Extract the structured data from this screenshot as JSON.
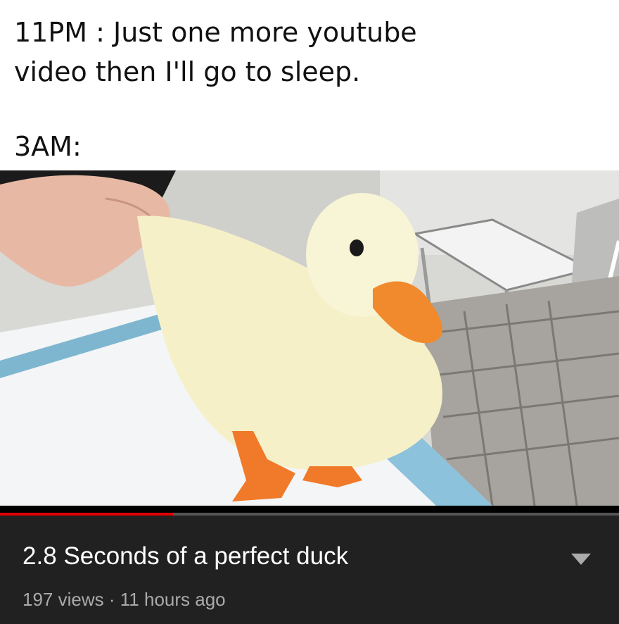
{
  "caption": {
    "line1": "11PM : Just one more youtube",
    "line2": "video then I'll go to sleep.",
    "line3": "3AM:"
  },
  "player": {
    "progress": 0.28,
    "played_color": "#e10000"
  },
  "video_info": {
    "title": "2.8 Seconds of a perfect duck",
    "views": "197 views",
    "separator": "·",
    "age": "11 hours ago",
    "expand_icon": "chevron-down-icon"
  }
}
